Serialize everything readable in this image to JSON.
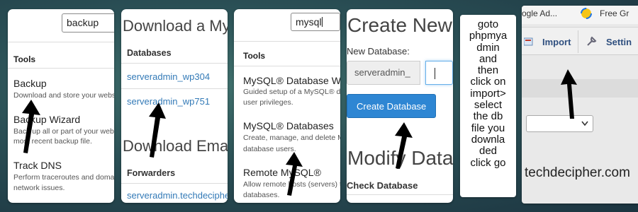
{
  "panel_cpanel_tools": {
    "search_value": "backup",
    "section_heading": "Tools",
    "items": [
      {
        "title": "Backup",
        "description": [
          "Download and store your website"
        ]
      },
      {
        "title": "Backup Wizard",
        "description": [
          "Back up all or part of your website",
          "most recent backup file."
        ]
      },
      {
        "title": "Track DNS",
        "description": [
          "Perform traceroutes and domain",
          "network issues."
        ]
      }
    ]
  },
  "panel_backups": {
    "heading_download": "Download a My",
    "databases_heading": "Databases",
    "databases": [
      "serveradmin_wp304",
      "serveradmin_wp751"
    ],
    "heading_email": "Download Ema",
    "forwarders_heading": "Forwarders",
    "forwarders": [
      "serveradmin.techdecipher"
    ]
  },
  "panel_mysql_tools": {
    "search_value": "mysql",
    "section_heading": "Tools",
    "items": [
      {
        "title": "MySQL® Database Wiz",
        "description": [
          "Guided setup of a MySQL® database",
          "user privileges."
        ]
      },
      {
        "title": "MySQL® Databases",
        "description": [
          "Create, manage, and delete My",
          "database users."
        ]
      },
      {
        "title": "Remote MySQL®",
        "description": [
          "Allow remote hosts (servers) to",
          "databases."
        ]
      }
    ]
  },
  "panel_create_db": {
    "heading": "Create New",
    "new_db_label": "New Database:",
    "prefix": "serveradmin_",
    "input_value": "",
    "create_button": "Create Database",
    "modify_heading": "Modify Data",
    "check_label": "Check Database"
  },
  "panel_note": {
    "lines": [
      "goto",
      "phpmya",
      "dmin",
      "and",
      "then",
      "click on",
      "import>",
      "select",
      "the db",
      "file you",
      "downla",
      "ded",
      "click go"
    ]
  },
  "panel_phpmyadmin": {
    "browser_tab_1": "ogle Ad...",
    "browser_tab_2": "Free Gr",
    "import_label": "Import",
    "settings_label": "Settin",
    "watermark": "techdecipher.com"
  },
  "colors": {
    "background": "#2a4f55",
    "link": "#337ab7",
    "button": "#2e86d3",
    "arrow": "#000000"
  }
}
